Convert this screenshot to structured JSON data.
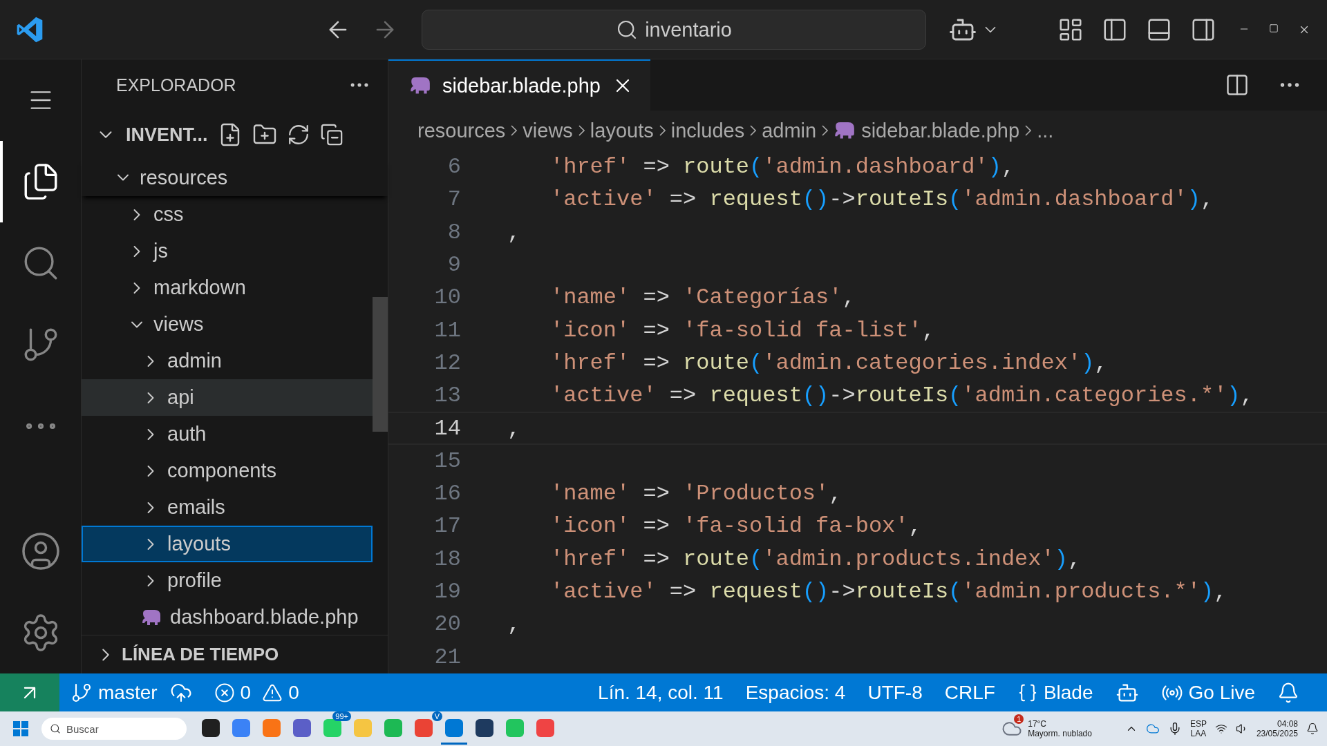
{
  "title_bar": {
    "search": "inventario"
  },
  "activity_bar": {
    "items": [
      {
        "kind": "explorer",
        "selected": true
      },
      {
        "kind": "search",
        "selected": false
      },
      {
        "kind": "source-control",
        "selected": false
      },
      {
        "kind": "more",
        "selected": false
      }
    ],
    "bottom": [
      {
        "kind": "account"
      },
      {
        "kind": "settings"
      }
    ]
  },
  "sidebar": {
    "title": "EXPLORADOR",
    "workspace": {
      "label": "INVENT...",
      "expanded": true
    },
    "tree": [
      {
        "label": "resources",
        "kind": "folder",
        "expanded": true,
        "selected": false,
        "hovered": false,
        "children": [
          {
            "label": "css",
            "kind": "folder",
            "expanded": false,
            "selected": false,
            "hovered": false
          },
          {
            "label": "js",
            "kind": "folder",
            "expanded": false,
            "selected": false,
            "hovered": false
          },
          {
            "label": "markdown",
            "kind": "folder",
            "expanded": false,
            "selected": false,
            "hovered": false
          },
          {
            "label": "views",
            "kind": "folder",
            "expanded": true,
            "selected": false,
            "hovered": false,
            "children": [
              {
                "label": "admin",
                "kind": "folder",
                "expanded": false,
                "selected": false,
                "hovered": false
              },
              {
                "label": "api",
                "kind": "folder",
                "expanded": false,
                "selected": false,
                "hovered": true
              },
              {
                "label": "auth",
                "kind": "folder",
                "expanded": false,
                "selected": false,
                "hovered": false
              },
              {
                "label": "components",
                "kind": "folder",
                "expanded": false,
                "selected": false,
                "hovered": false
              },
              {
                "label": "emails",
                "kind": "folder",
                "expanded": false,
                "selected": false,
                "hovered": false
              },
              {
                "label": "layouts",
                "kind": "folder",
                "expanded": false,
                "selected": true,
                "hovered": false
              },
              {
                "label": "profile",
                "kind": "folder",
                "expanded": false,
                "selected": false,
                "hovered": false
              },
              {
                "label": "dashboard.blade.php",
                "kind": "file",
                "expanded": false,
                "selected": false,
                "hovered": false
              }
            ]
          }
        ]
      }
    ],
    "sections": [
      {
        "label": "LÍNEA DE TIEMPO",
        "expanded": false
      }
    ]
  },
  "editor": {
    "tabs": [
      {
        "label": "sidebar.blade.php",
        "selected": true
      }
    ],
    "breadcrumbs": [
      {
        "label": "resources",
        "kind": "folder"
      },
      {
        "label": "views",
        "kind": "folder"
      },
      {
        "label": "layouts",
        "kind": "folder"
      },
      {
        "label": "includes",
        "kind": "folder"
      },
      {
        "label": "admin",
        "kind": "folder"
      },
      {
        "label": "sidebar.blade.php",
        "kind": "file"
      },
      {
        "label": "...",
        "kind": "more"
      }
    ],
    "lines": [
      {
        "number": "6",
        "current": false,
        "tokens": [
          {
            "kind": "str",
            "text": "'href'"
          },
          {
            "kind": "op",
            "text": " => "
          },
          {
            "kind": "fn",
            "text": "route"
          },
          {
            "kind": "paren",
            "text": "("
          },
          {
            "kind": "str",
            "text": "'admin.dashboard'"
          },
          {
            "kind": "paren",
            "text": ")"
          },
          {
            "kind": "op",
            "text": ","
          }
        ]
      },
      {
        "number": "7",
        "current": false,
        "tokens": [
          {
            "kind": "str",
            "text": "'active'"
          },
          {
            "kind": "op",
            "text": " => "
          },
          {
            "kind": "fn",
            "text": "request"
          },
          {
            "kind": "paren",
            "text": "()"
          },
          {
            "kind": "op",
            "text": "->"
          },
          {
            "kind": "fn",
            "text": "routeIs"
          },
          {
            "kind": "paren",
            "text": "("
          },
          {
            "kind": "str",
            "text": "'admin.dashboard'"
          },
          {
            "kind": "paren",
            "text": ")"
          },
          {
            "kind": "op",
            "text": ","
          }
        ]
      },
      {
        "number": "8",
        "current": false,
        "tokens": [
          {
            "kind": "op",
            "text": ","
          }
        ]
      },
      {
        "number": "9",
        "current": false
      },
      {
        "number": "10",
        "current": false,
        "tokens": [
          {
            "kind": "str",
            "text": "'name'"
          },
          {
            "kind": "op",
            "text": " => "
          },
          {
            "kind": "str",
            "text": "'Categorías'"
          },
          {
            "kind": "op",
            "text": ","
          }
        ]
      },
      {
        "number": "11",
        "current": false,
        "tokens": [
          {
            "kind": "str",
            "text": "'icon'"
          },
          {
            "kind": "op",
            "text": " => "
          },
          {
            "kind": "str",
            "text": "'fa-solid fa-list'"
          },
          {
            "kind": "op",
            "text": ","
          }
        ]
      },
      {
        "number": "12",
        "current": false,
        "tokens": [
          {
            "kind": "str",
            "text": "'href'"
          },
          {
            "kind": "op",
            "text": " => "
          },
          {
            "kind": "fn",
            "text": "route"
          },
          {
            "kind": "paren",
            "text": "("
          },
          {
            "kind": "str",
            "text": "'admin.categories.index'"
          },
          {
            "kind": "paren",
            "text": ")"
          },
          {
            "kind": "op",
            "text": ","
          }
        ]
      },
      {
        "number": "13",
        "current": false,
        "tokens": [
          {
            "kind": "str",
            "text": "'active'"
          },
          {
            "kind": "op",
            "text": " => "
          },
          {
            "kind": "fn",
            "text": "request"
          },
          {
            "kind": "paren",
            "text": "()"
          },
          {
            "kind": "op",
            "text": "->"
          },
          {
            "kind": "fn",
            "text": "routeIs"
          },
          {
            "kind": "paren",
            "text": "("
          },
          {
            "kind": "str",
            "text": "'admin.categories.*'"
          },
          {
            "kind": "paren",
            "text": ")"
          },
          {
            "kind": "op",
            "text": ","
          }
        ]
      },
      {
        "number": "14",
        "current": true,
        "tokens": [
          {
            "kind": "op",
            "text": ","
          }
        ]
      },
      {
        "number": "15",
        "current": false
      },
      {
        "number": "16",
        "current": false,
        "tokens": [
          {
            "kind": "str",
            "text": "'name'"
          },
          {
            "kind": "op",
            "text": " => "
          },
          {
            "kind": "str",
            "text": "'Productos'"
          },
          {
            "kind": "op",
            "text": ","
          }
        ]
      },
      {
        "number": "17",
        "current": false,
        "tokens": [
          {
            "kind": "str",
            "text": "'icon'"
          },
          {
            "kind": "op",
            "text": " => "
          },
          {
            "kind": "str",
            "text": "'fa-solid fa-box'"
          },
          {
            "kind": "op",
            "text": ","
          }
        ]
      },
      {
        "number": "18",
        "current": false,
        "tokens": [
          {
            "kind": "str",
            "text": "'href'"
          },
          {
            "kind": "op",
            "text": " => "
          },
          {
            "kind": "fn",
            "text": "route"
          },
          {
            "kind": "paren",
            "text": "("
          },
          {
            "kind": "str",
            "text": "'admin.products.index'"
          },
          {
            "kind": "paren",
            "text": ")"
          },
          {
            "kind": "op",
            "text": ","
          }
        ]
      },
      {
        "number": "19",
        "current": false,
        "tokens": [
          {
            "kind": "str",
            "text": "'active'"
          },
          {
            "kind": "op",
            "text": " => "
          },
          {
            "kind": "fn",
            "text": "request"
          },
          {
            "kind": "paren",
            "text": "()"
          },
          {
            "kind": "op",
            "text": "->"
          },
          {
            "kind": "fn",
            "text": "routeIs"
          },
          {
            "kind": "paren",
            "text": "("
          },
          {
            "kind": "str",
            "text": "'admin.products.*'"
          },
          {
            "kind": "paren",
            "text": ")"
          },
          {
            "kind": "op",
            "text": ","
          }
        ]
      },
      {
        "number": "20",
        "current": false,
        "tokens": [
          {
            "kind": "op",
            "text": ","
          }
        ]
      },
      {
        "number": "21",
        "current": false
      }
    ]
  },
  "status_bar": {
    "branch": "master",
    "errors": "0",
    "warnings": "0",
    "items": [
      "Lín. 14, col. 11",
      "Espacios: 4",
      "UTF-8",
      "CRLF"
    ],
    "language": "Blade",
    "live": "Go Live"
  },
  "taskbar": {
    "search": "Buscar",
    "apps": [
      {
        "color": "#202020",
        "selected": false
      },
      {
        "color": "#3b82f6",
        "selected": false
      },
      {
        "color": "#f97316",
        "selected": false
      },
      {
        "color": "#5b5fc7",
        "selected": false
      },
      {
        "color": "#25d366",
        "selected": false,
        "badge": "99+"
      },
      {
        "color": "#f5c542",
        "selected": false
      },
      {
        "color": "#1db954",
        "selected": false
      },
      {
        "color": "#ea4335",
        "selected": false,
        "badge": "V"
      },
      {
        "color": "#0078d4",
        "selected": true
      },
      {
        "color": "#1e3a5f",
        "selected": false
      },
      {
        "color": "#22c55e",
        "selected": false
      },
      {
        "color": "#ef4444",
        "selected": false
      }
    ],
    "weather": {
      "badge": "1",
      "temp": "17°C",
      "text": "Mayorm. nublado"
    },
    "language": [
      "ESP",
      "LAA"
    ],
    "time": "04:08",
    "date": "23/05/2025"
  }
}
